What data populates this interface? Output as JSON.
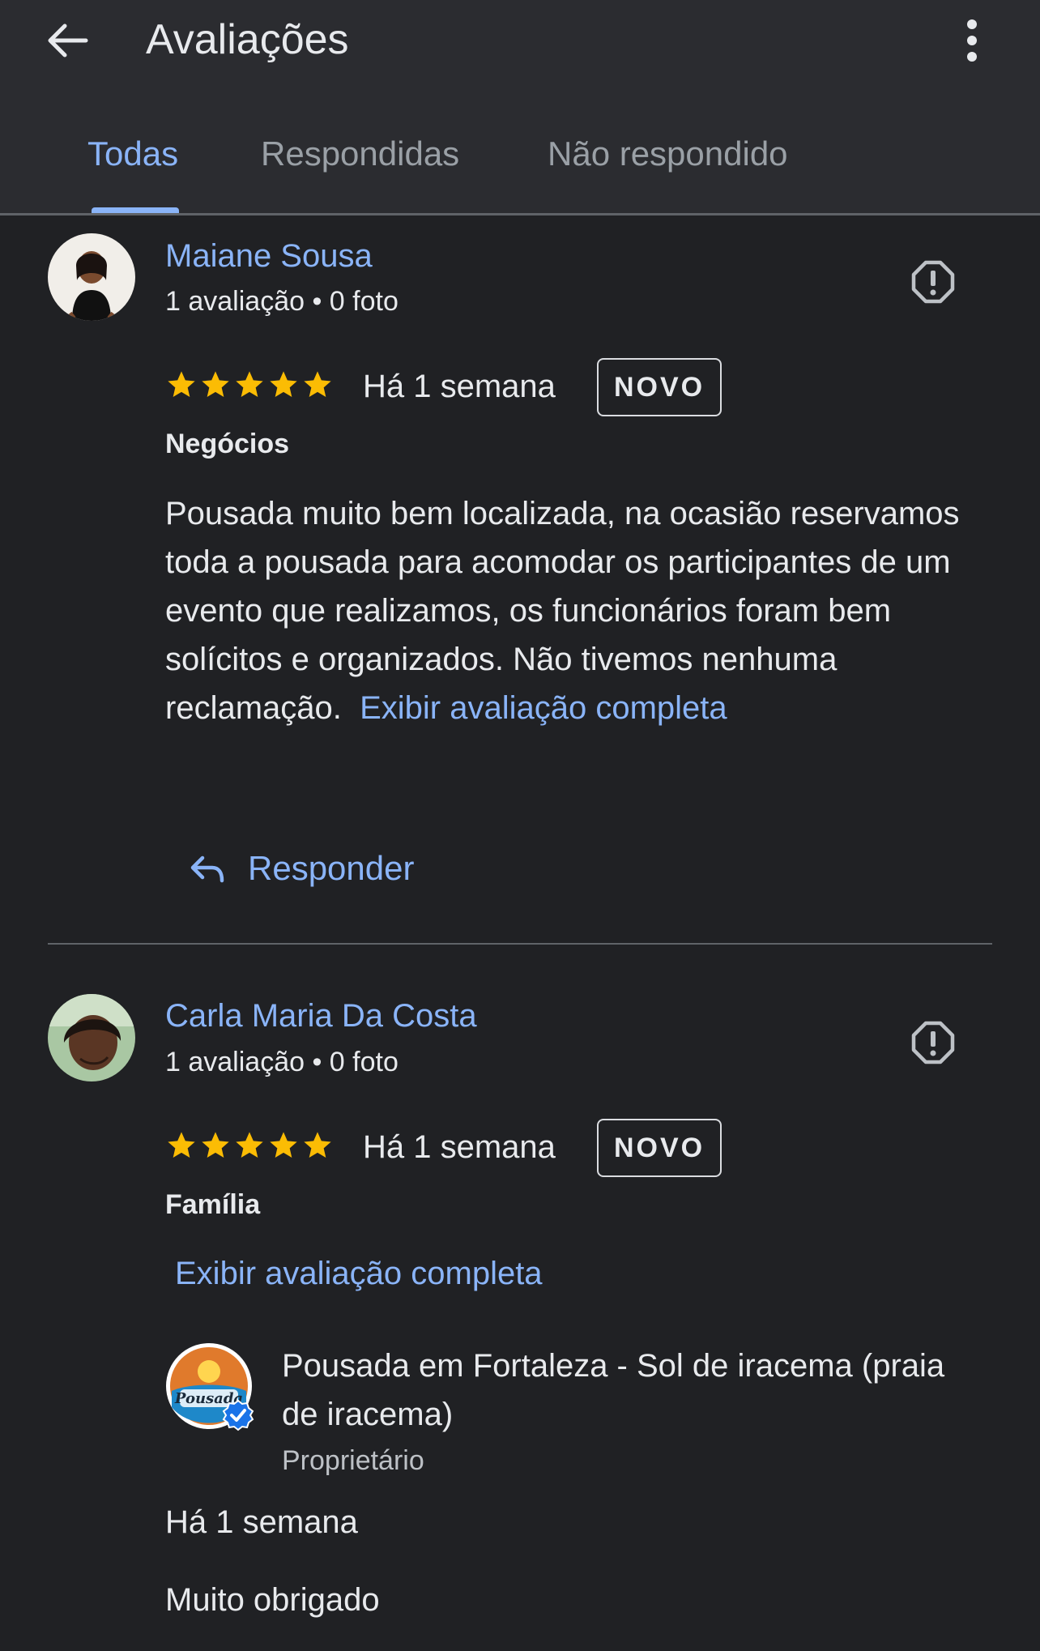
{
  "header": {
    "title": "Avaliações",
    "back_icon": "arrow-left-icon",
    "more_icon": "more-vert-icon"
  },
  "tabs": [
    {
      "label": "Todas",
      "active": true
    },
    {
      "label": "Respondidas",
      "active": false
    },
    {
      "label": "Não respondido",
      "active": false
    }
  ],
  "colors": {
    "accent": "#8ab4f8",
    "background": "#202124",
    "header_bg": "#2b2c30",
    "star": "#fbbc04"
  },
  "reviews": [
    {
      "name": "Maiane Sousa",
      "meta": "1 avaliação • 0 foto",
      "rating": 5,
      "date": "Há 1 semana",
      "badge": "NOVO",
      "category": "Negócios",
      "text": "Pousada muito bem localizada, na ocasião reservamos toda a pousada para acomodar os participantes de um evento que realizamos, os funcionários foram bem solícitos e organizados. Não tivemos nenhuma reclamação.",
      "show_full": "Exibir avaliação completa",
      "reply_label": "Responder"
    },
    {
      "name": "Carla Maria Da Costa",
      "meta": "1 avaliação • 0 foto",
      "rating": 5,
      "date": "Há 1 semana",
      "badge": "NOVO",
      "category": "Família",
      "show_full": "Exibir avaliação completa",
      "owner_reply": {
        "name": "Pousada em Fortaleza - Sol de iracema (praia de iracema)",
        "role": "Proprietário",
        "date": "Há 1 semana",
        "text": "Muito obrigado",
        "logo_text": "Pousada"
      }
    }
  ]
}
